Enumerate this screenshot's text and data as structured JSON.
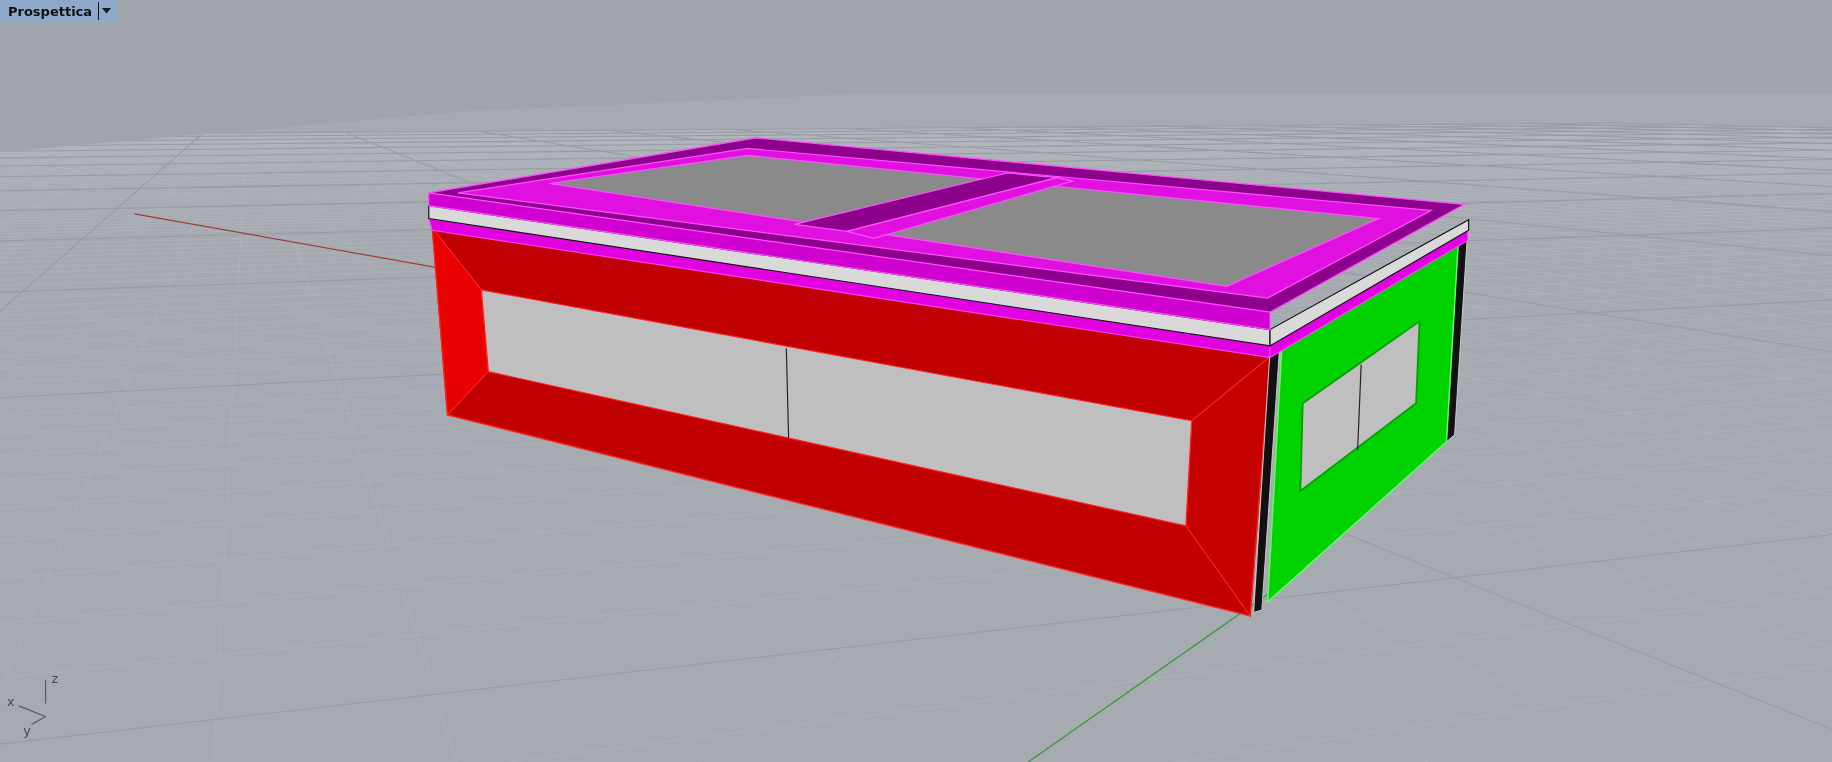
{
  "viewport": {
    "title": "Prospettica"
  },
  "axis_widget": {
    "labels": [
      {
        "kind": "z",
        "text": "z"
      },
      {
        "kind": "x",
        "text": "x"
      },
      {
        "kind": "y",
        "text": "y"
      }
    ]
  }
}
